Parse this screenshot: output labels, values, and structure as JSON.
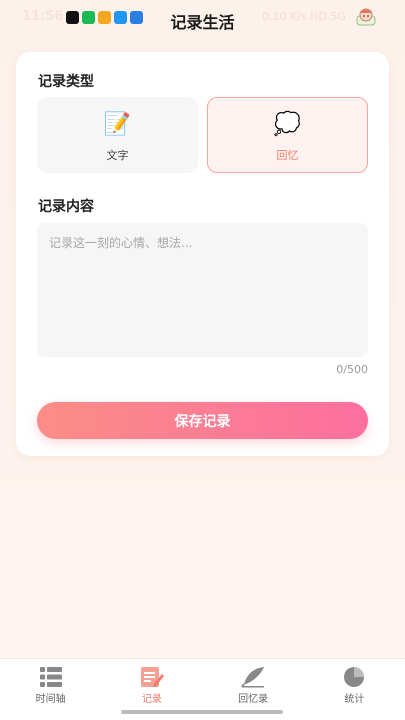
{
  "status_bar": {
    "time": "11:56",
    "right_text": "0.10 K/s  HD  5G",
    "app_icon_colors": [
      "#111111",
      "#1db954",
      "#f5a623",
      "#2196f3",
      "#2a7de1"
    ]
  },
  "header": {
    "title": "记录生活"
  },
  "record_type": {
    "label": "记录类型",
    "options": [
      {
        "label": "文字",
        "icon": "memo-icon",
        "glyph": "📝",
        "selected": false
      },
      {
        "label": "回忆",
        "icon": "thought-bubble-icon",
        "glyph": "💭",
        "selected": true
      }
    ]
  },
  "record_content": {
    "label": "记录内容",
    "placeholder": "记录这一刻的心情、想法...",
    "value": "",
    "char_count": "0/500"
  },
  "save_button": {
    "label": "保存记录"
  },
  "tab_bar": {
    "items": [
      {
        "label": "时间轴",
        "icon": "list-icon",
        "active": false
      },
      {
        "label": "记录",
        "icon": "edit-icon",
        "active": true
      },
      {
        "label": "回忆录",
        "icon": "quill-icon",
        "active": false
      },
      {
        "label": "统计",
        "icon": "pie-chart-icon",
        "active": false
      }
    ]
  },
  "colors": {
    "accent": "#f07a6a",
    "button_gradient_start": "#fb8d86",
    "button_gradient_end": "#fc6fa0",
    "inactive_icon": "#888888"
  }
}
